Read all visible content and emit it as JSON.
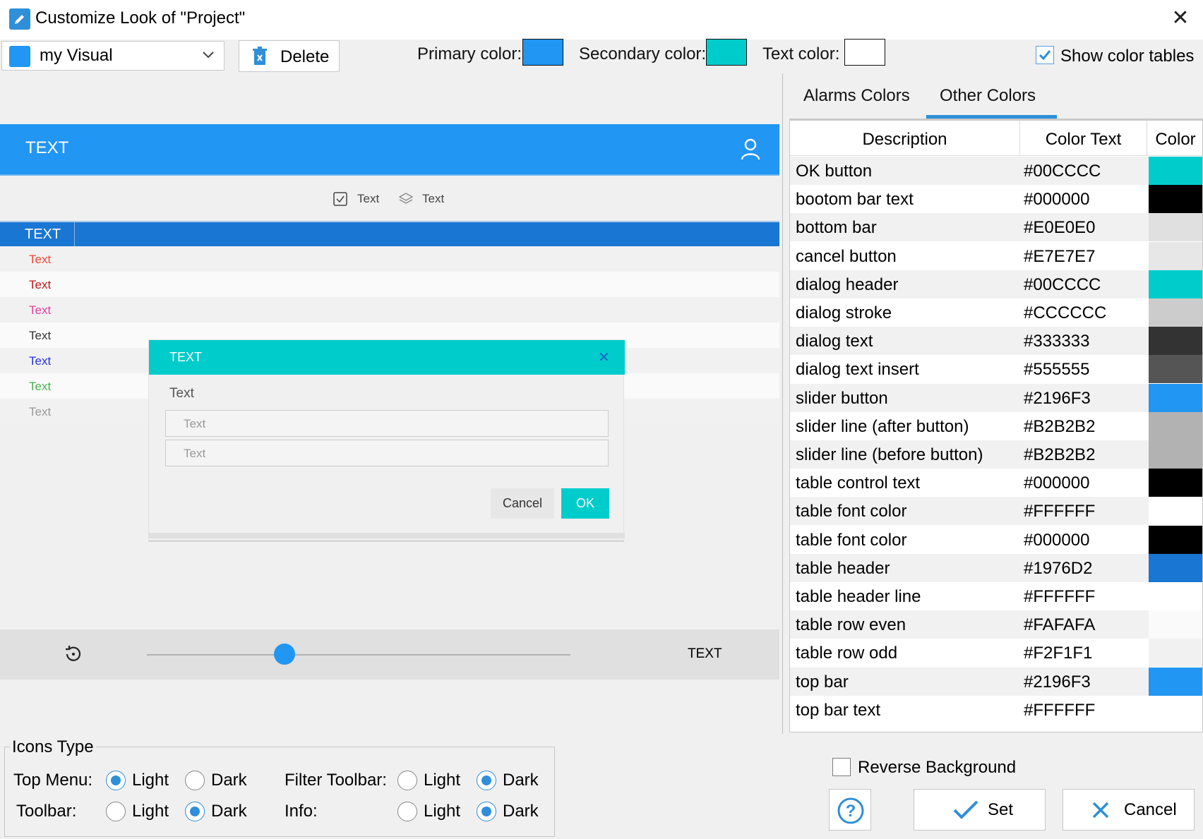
{
  "window": {
    "title": "Customize Look of \"Project\"",
    "close_glyph": "✕"
  },
  "toolbar": {
    "visual_name": "my Visual",
    "visual_color": "#2196F3",
    "delete_label": "Delete",
    "primary_label": "Primary color:",
    "primary_color": "#2196F3",
    "secondary_label": "Secondary color:",
    "secondary_color": "#00CCCC",
    "text_label": "Text color:",
    "text_color": "#FFFFFF",
    "show_tables_label": "Show color tables",
    "show_tables_checked": true
  },
  "preview": {
    "top_bar_text": "TEXT",
    "mini_check_text": "Text",
    "mini_layers_text": "Text",
    "table_header": "TEXT",
    "rows": [
      {
        "text": "Text",
        "color": "#F44336",
        "bg": "#F2F1F1"
      },
      {
        "text": "Text",
        "color": "#B71C1C",
        "bg": "#FAFAFA"
      },
      {
        "text": "Text",
        "color": "#E040A0",
        "bg": "#F2F1F1"
      },
      {
        "text": "Text",
        "color": "#333333",
        "bg": "#FAFAFA"
      },
      {
        "text": "Text",
        "color": "#2233DD",
        "bg": "#F2F1F1"
      },
      {
        "text": "Text",
        "color": "#4CAF50",
        "bg": "#FAFAFA"
      },
      {
        "text": "Text",
        "color": "#999999",
        "bg": "#F2F1F1"
      }
    ],
    "dialog": {
      "header": "TEXT",
      "close": "✕",
      "text": "Text",
      "input1": "Text",
      "input2": "Text",
      "cancel": "Cancel",
      "ok": "OK"
    },
    "bottom_bar_text": "TEXT",
    "slider_value": 0.33
  },
  "tabs": [
    {
      "label": "Alarms Colors",
      "active": false
    },
    {
      "label": "Other Colors",
      "active": true
    }
  ],
  "color_table": {
    "headers": [
      "Description",
      "Color Text",
      "Color"
    ],
    "rows": [
      {
        "desc": "OK button",
        "hex": "#00CCCC",
        "color": "#00CCCC"
      },
      {
        "desc": "bootom bar text",
        "hex": "#000000",
        "color": "#000000"
      },
      {
        "desc": "bottom bar",
        "hex": "#E0E0E0",
        "color": "#E0E0E0"
      },
      {
        "desc": "cancel button",
        "hex": "#E7E7E7",
        "color": "#E7E7E7"
      },
      {
        "desc": "dialog header",
        "hex": "#00CCCC",
        "color": "#00CCCC"
      },
      {
        "desc": "dialog stroke",
        "hex": "#CCCCCC",
        "color": "#CCCCCC"
      },
      {
        "desc": "dialog text",
        "hex": "#333333",
        "color": "#333333"
      },
      {
        "desc": "dialog text insert",
        "hex": "#555555",
        "color": "#555555"
      },
      {
        "desc": "slider button",
        "hex": "#2196F3",
        "color": "#2196F3"
      },
      {
        "desc": "slider line (after button)",
        "hex": "#B2B2B2",
        "color": "#B2B2B2"
      },
      {
        "desc": "slider line (before button)",
        "hex": "#B2B2B2",
        "color": "#B2B2B2"
      },
      {
        "desc": "table control text",
        "hex": "#000000",
        "color": "#000000"
      },
      {
        "desc": "table font color",
        "hex": "#FFFFFF",
        "color": "#FFFFFF"
      },
      {
        "desc": "table font color",
        "hex": "#000000",
        "color": "#000000"
      },
      {
        "desc": "table header",
        "hex": "#1976D2",
        "color": "#1976D2"
      },
      {
        "desc": "table header line",
        "hex": "#FFFFFF",
        "color": "#FFFFFF"
      },
      {
        "desc": "table row even",
        "hex": "#FAFAFA",
        "color": "#FAFAFA"
      },
      {
        "desc": "table row odd",
        "hex": "#F2F1F1",
        "color": "#F2F1F1"
      },
      {
        "desc": "top bar",
        "hex": "#2196F3",
        "color": "#2196F3"
      },
      {
        "desc": "top bar text",
        "hex": "#FFFFFF",
        "color": "#FFFFFF"
      }
    ]
  },
  "icons_type": {
    "title": "Icons Type",
    "top_menu_label": "Top Menu:",
    "toolbar_label": "Toolbar:",
    "filter_toolbar_label": "Filter Toolbar:",
    "info_label": "Info:",
    "light": "Light",
    "dark": "Dark",
    "top_menu": "Light",
    "toolbar": "Dark",
    "filter_toolbar": "Dark",
    "info": "Dark"
  },
  "footer": {
    "reverse_label": "Reverse Background",
    "reverse_checked": false,
    "help_glyph": "?",
    "set_label": "Set",
    "cancel_label": "Cancel"
  }
}
